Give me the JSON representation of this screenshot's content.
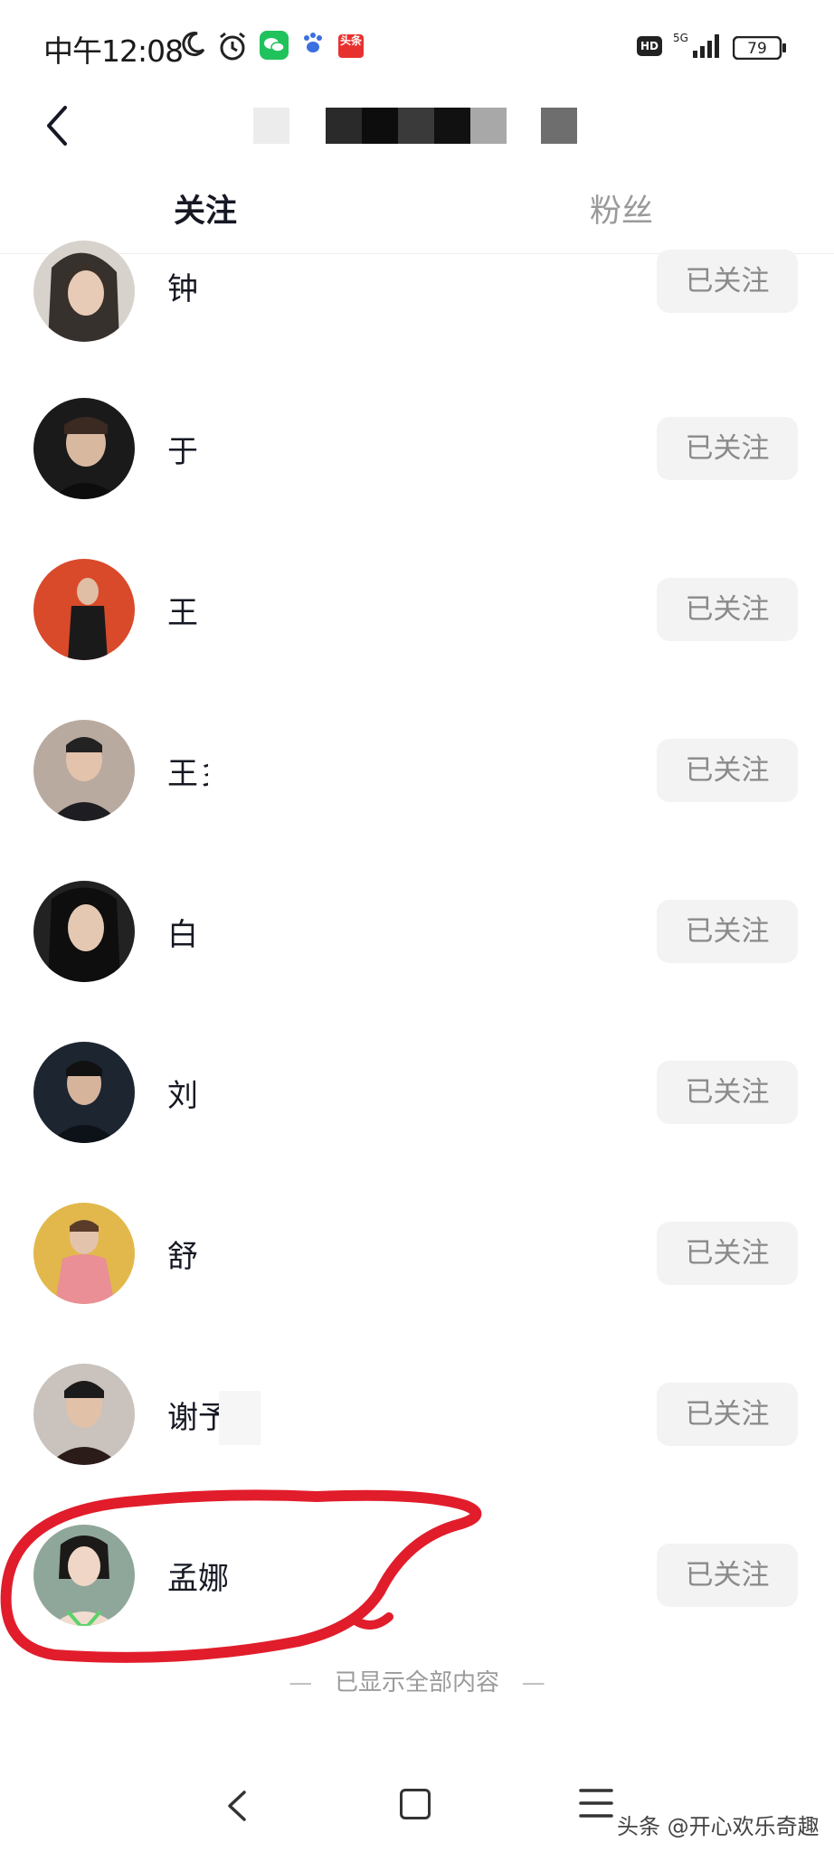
{
  "status_bar": {
    "time": "中午12:08",
    "network": "5G",
    "battery": "79",
    "hd_label": "HD",
    "toutiao_label": "头条"
  },
  "header": {
    "back_icon": "chevron-left-icon"
  },
  "tabs": [
    {
      "label": "关注",
      "active": true
    },
    {
      "label": "粉丝",
      "active": false
    }
  ],
  "follow_list": [
    {
      "name": "钟",
      "button": "已关注"
    },
    {
      "name": "于",
      "button": "已关注"
    },
    {
      "name": "王",
      "button": "已关注"
    },
    {
      "name": "王彡",
      "button": "已关注"
    },
    {
      "name": "白",
      "button": "已关注"
    },
    {
      "name": "刘",
      "button": "已关注"
    },
    {
      "name": "舒",
      "button": "已关注"
    },
    {
      "name": "谢予",
      "button": "已关注"
    },
    {
      "name": "孟娜",
      "button": "已关注"
    }
  ],
  "end_text": "已显示全部内容",
  "end_dash": "—",
  "navbar": {
    "watermark": "头条 @开心欢乐奇趣"
  },
  "colors": {
    "accent_red": "#e11d2b",
    "button_bg": "#f3f3f4",
    "button_text": "#8a8a8a"
  }
}
